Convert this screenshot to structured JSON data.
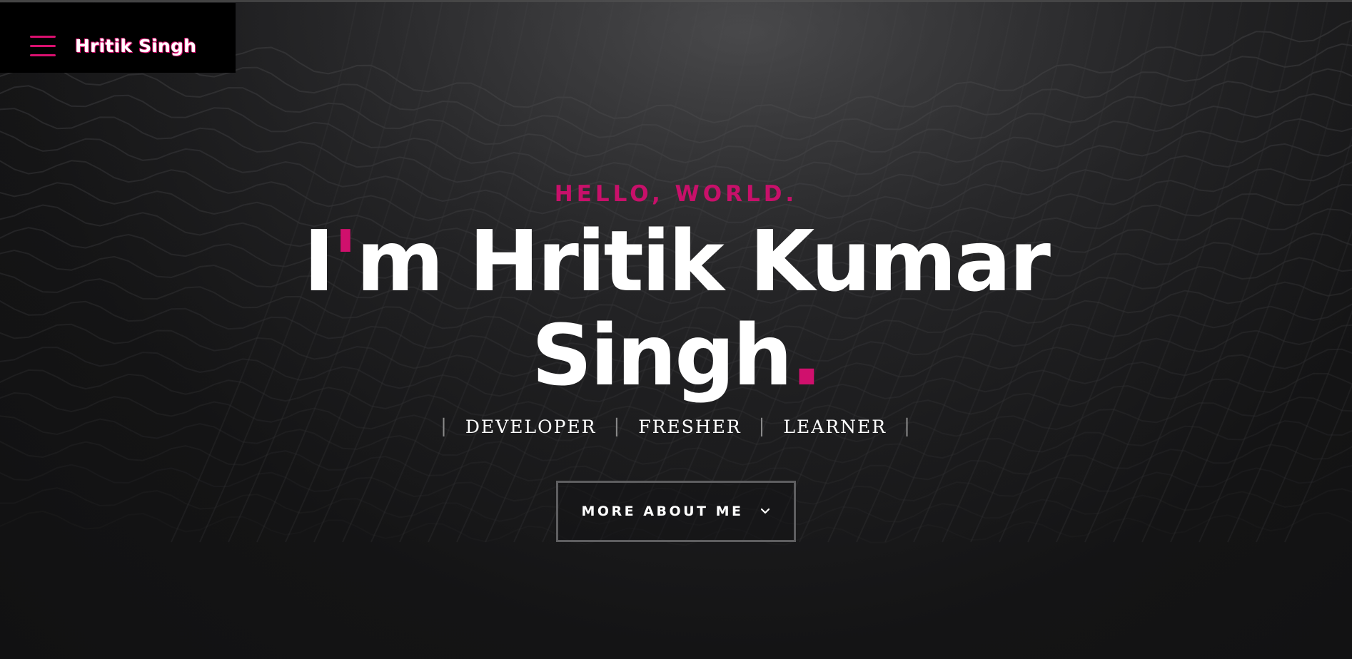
{
  "header": {
    "brand_name": "Hritik Singh",
    "menu_icon": "hamburger-menu-icon"
  },
  "hero": {
    "greeting": "HELLO, WORLD.",
    "headline_i": "I",
    "headline_apostrophe": "'",
    "headline_rest_line1": "m Hritik Kumar",
    "headline_line2": "Singh",
    "headline_period": ".",
    "roles": [
      "DEVELOPER",
      "FRESHER",
      "LEARNER"
    ],
    "role_separator": "|",
    "cta_label": "MORE ABOUT ME",
    "cta_icon": "chevron-down-icon"
  },
  "colors": {
    "accent": "#d0106d",
    "background": "#121213",
    "text": "#ffffff"
  }
}
